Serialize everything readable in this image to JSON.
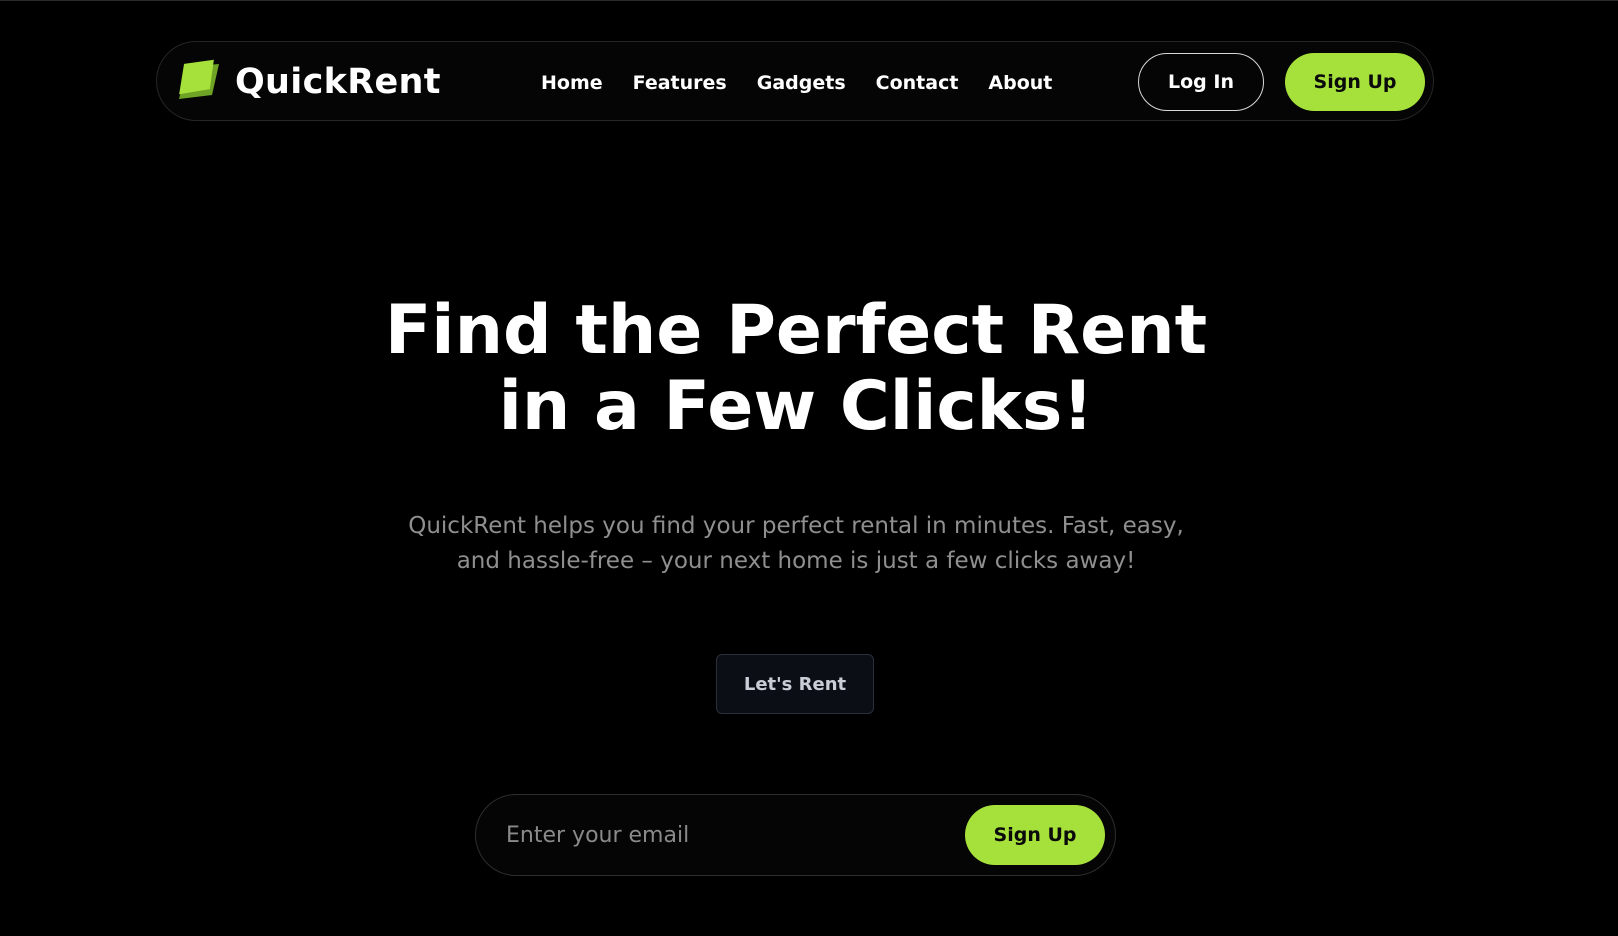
{
  "colors": {
    "background": "#000000",
    "accent": "#a6e13b",
    "accent_dark": "#6fa326",
    "text_primary": "#ffffff",
    "text_muted": "#8f8f8f",
    "rent_button_bg": "#0b0e14"
  },
  "navbar": {
    "logo_icon": "leaf-logo-icon",
    "brand_name": "QuickRent",
    "links": [
      {
        "label": "Home"
      },
      {
        "label": "Features"
      },
      {
        "label": "Gadgets"
      },
      {
        "label": "Contact"
      },
      {
        "label": "About"
      }
    ],
    "login_label": "Log In",
    "signup_label": "Sign Up"
  },
  "hero": {
    "title_line1": "Find the Perfect Rent",
    "title_line2": "in a Few Clicks!",
    "subtitle_line1": "QuickRent helps you find your perfect rental in minutes. Fast, easy,",
    "subtitle_line2": "and hassle-free – your next home is just a few clicks away!",
    "cta_label": "Let's Rent"
  },
  "signup_form": {
    "email_placeholder": "Enter your email",
    "email_value": "",
    "submit_label": "Sign Up"
  }
}
